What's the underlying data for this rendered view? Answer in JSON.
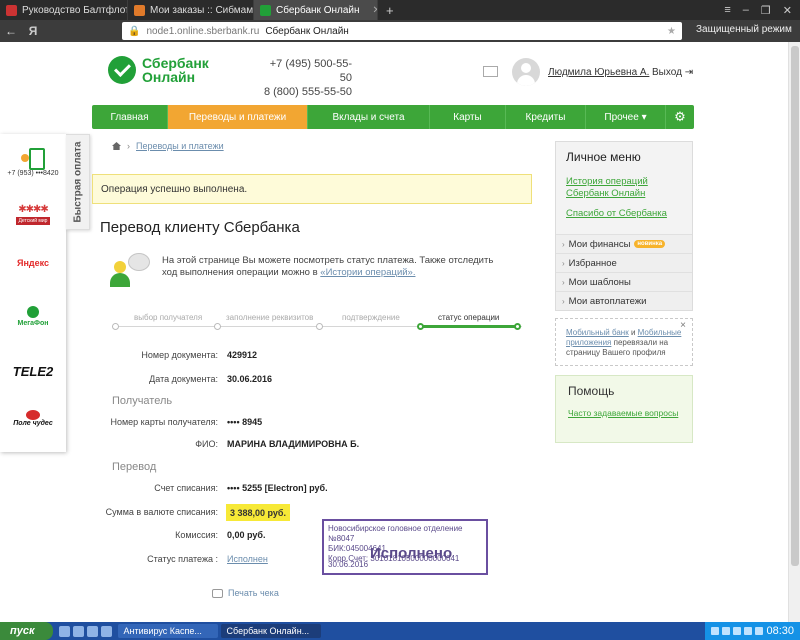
{
  "browser": {
    "tabs": [
      {
        "title": "Руководство Балтфлота се",
        "icon": "flag-icon",
        "color": "#cc3333"
      },
      {
        "title": "Мои заказы :: Сибмама - о",
        "icon": "sibmama-icon",
        "color": "#e07a2a"
      },
      {
        "title": "Сбербанк Онлайн",
        "icon": "sberbank-icon",
        "color": "#21a038"
      }
    ],
    "new_tab": "+",
    "address_url": "node1.online.sberbank.ru",
    "address_title": "Сбербанк Онлайн",
    "secure_mode": "Защищенный режим"
  },
  "header": {
    "logo_line1": "Сбербанк",
    "logo_line2": "Онлайн",
    "phone1": "+7 (495) 500-55-50",
    "phone2": "8 (800) 555-55-50",
    "user_name": "Людмила Юрьевна А.",
    "logout": "Выход"
  },
  "nav": {
    "items": [
      "Главная",
      "Переводы и платежи",
      "Вклады и счета",
      "Карты",
      "Кредиты",
      "Прочее ▾"
    ],
    "active_index": 1
  },
  "quickpay": {
    "tab_label": "Быстрая оплата",
    "phone": "+7 (953) •••8420",
    "brands": [
      "Детский мир",
      "Яндекс",
      "МегаФон",
      "TELE2",
      "Поле чудес"
    ]
  },
  "breadcrumb": {
    "link": "Переводы и платежи"
  },
  "success_message": "Операция успешно выполнена.",
  "title": "Перевод клиенту Сбербанка",
  "info": {
    "text": "На этой странице Вы можете посмотреть статус платежа. Также отследить ход выполнения операции можно в ",
    "link": "«Истории операций»."
  },
  "steps": [
    "выбор получателя",
    "заполнение реквизитов",
    "подтверждение",
    "статус операции"
  ],
  "details": {
    "doc_number_label": "Номер документа:",
    "doc_number": "429912",
    "doc_date_label": "Дата документа:",
    "doc_date": "30.06.2016",
    "recipient_title": "Получатель",
    "card_label": "Номер карты получателя:",
    "card": "•••• 8945",
    "fio_label": "ФИО:",
    "fio": "МАРИНА ВЛАДИМИРОВНА Б.",
    "transfer_title": "Перевод",
    "account_label": "Счет списания:",
    "account": "•••• 5255  [Electron]  руб.",
    "sum_label": "Сумма в валюте списания:",
    "sum": "3 388,00  руб.",
    "fee_label": "Комиссия:",
    "fee": "0,00 руб.",
    "status_label": "Статус платежа :",
    "status": "Исполнен",
    "print": "Печать чека"
  },
  "stamp": {
    "line1": "Новосибирское головное отделение №8047",
    "line2": "БИК:045004641",
    "line3": "Корр.Счет: 30101810500000000641",
    "status": "Исполнено",
    "date": "30.06.2016"
  },
  "personal_menu": {
    "title": "Личное меню",
    "links": [
      "История операций Сбербанк Онлайн",
      "Спасибо от Сбербанка"
    ],
    "rows": [
      "Мои финансы",
      "Избранное",
      "Мои шаблоны",
      "Мои автоплатежи"
    ],
    "new_badge": "новинка"
  },
  "mobile_note": {
    "link1": "Мобильный банк",
    "and": " и ",
    "link2": "Мобильные приложения",
    "rest": " перевязали на страницу Вашего профиля",
    "close": "×"
  },
  "help": {
    "title": "Помощь",
    "link": "Часто задаваемые вопросы"
  },
  "taskbar": {
    "start": "пуск",
    "tasks": [
      "Антивирус Каспе...",
      "Сбербанк Онлайн..."
    ],
    "clock": "08:30"
  }
}
